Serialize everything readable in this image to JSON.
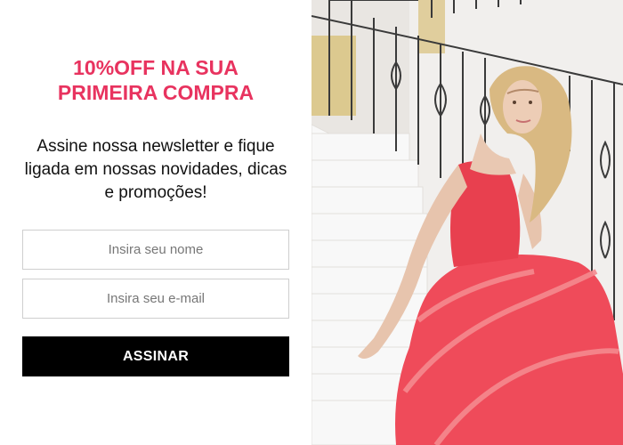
{
  "promo": {
    "headline_line1": "10%OFF NA SUA",
    "headline_line2": "PRIMEIRA COMPRA",
    "description": "Assine nossa newsletter e fique ligada em nossas novidades, dicas e promoções!"
  },
  "form": {
    "name_placeholder": "Insira seu nome",
    "email_placeholder": "Insira seu e-mail",
    "submit_label": "ASSINAR"
  },
  "colors": {
    "accent": "#e8335f",
    "button": "#000000",
    "dress": "#ef4b5a"
  }
}
